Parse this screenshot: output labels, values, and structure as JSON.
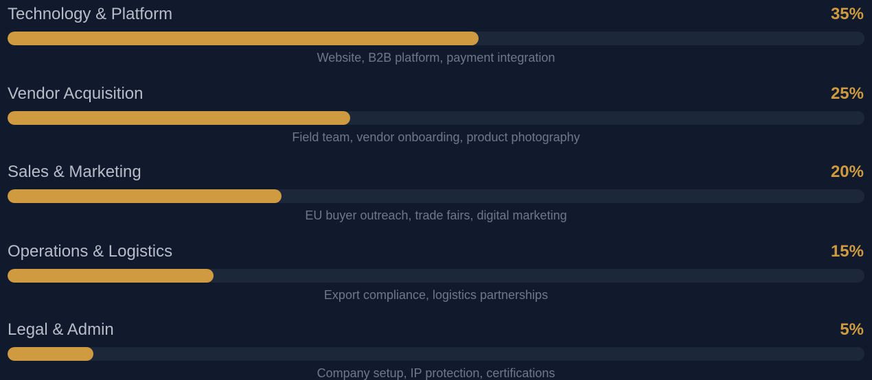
{
  "allocation": {
    "items": [
      {
        "label": "Technology & Platform",
        "percent_label": "35%",
        "fill_fraction": 0.55,
        "description": "Website, B2B platform, payment integration"
      },
      {
        "label": "Vendor Acquisition",
        "percent_label": "25%",
        "fill_fraction": 0.4,
        "description": "Field team, vendor onboarding, product photography"
      },
      {
        "label": "Sales & Marketing",
        "percent_label": "20%",
        "fill_fraction": 0.32,
        "description": "EU buyer outreach, trade fairs, digital marketing"
      },
      {
        "label": "Operations & Logistics",
        "percent_label": "15%",
        "fill_fraction": 0.24,
        "description": "Export compliance, logistics partnerships"
      },
      {
        "label": "Legal & Admin",
        "percent_label": "5%",
        "fill_fraction": 0.1,
        "description": "Company setup, IP protection, certifications"
      }
    ]
  },
  "colors": {
    "background": "#101a2c",
    "accent": "#cf9a40",
    "track": "#1c2839",
    "label_text": "#b6bdc9",
    "description_text": "#6f7889"
  }
}
